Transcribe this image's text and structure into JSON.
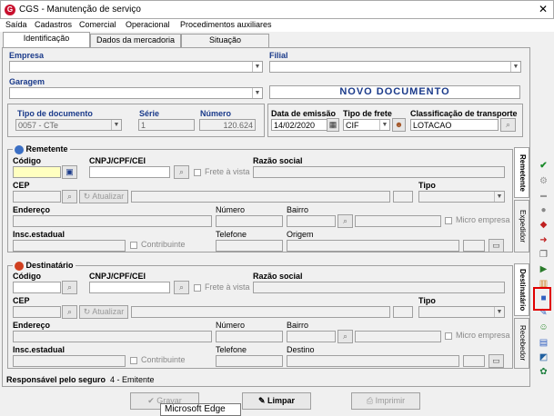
{
  "window": {
    "title": "CGS - Manutenção de serviço",
    "close": "✕"
  },
  "menu": [
    "Saída",
    "Cadastros",
    "Comercial",
    "Operacional",
    "Procedimentos auxiliares"
  ],
  "tabs": [
    "Identificação",
    "Dados da mercadoria",
    "Situação"
  ],
  "header": {
    "empresa_label": "Empresa",
    "filial_label": "Filial",
    "garagem_label": "Garagem",
    "status_banner": "NOVO DOCUMENTO",
    "tipo_doc_label": "Tipo de documento",
    "tipo_doc_value": "0057 - CTe",
    "serie_label": "Série",
    "serie_value": "1",
    "numero_label": "Número",
    "numero_value": "120.624",
    "data_emissao_label": "Data de emissão",
    "data_emissao_value": "14/02/2020",
    "tipo_frete_label": "Tipo de frete",
    "tipo_frete_value": "CIF",
    "classificacao_label": "Classificação de transporte",
    "classificacao_value": "LOTACAO"
  },
  "remetente": {
    "title": "Remetente",
    "codigo": "Código",
    "cnpj": "CNPJ/CPF/CEI",
    "frete_vista": "Frete à vista",
    "razao": "Razão social",
    "cep": "CEP",
    "atualizar": "Atualizar",
    "tipo": "Tipo",
    "endereco": "Endereço",
    "numero": "Número",
    "bairro": "Bairro",
    "micro": "Micro empresa",
    "insc": "Insc.estadual",
    "contribuinte": "Contribuinte",
    "telefone": "Telefone",
    "origem": "Origem"
  },
  "destinatario": {
    "title": "Destinatário",
    "codigo": "Código",
    "cnpj": "CNPJ/CPF/CEI",
    "frete_vista": "Frete à vista",
    "razao": "Razão social",
    "cep": "CEP",
    "atualizar": "Atualizar",
    "tipo": "Tipo",
    "endereco": "Endereço",
    "numero": "Número",
    "bairro": "Bairro",
    "micro": "Micro empresa",
    "insc": "Insc.estadual",
    "contribuinte": "Contribuinte",
    "telefone": "Telefone",
    "destino": "Destino"
  },
  "vtabs": {
    "remetente": "Remetente",
    "expedidor": "Expedidor",
    "destinatario": "Destinatário",
    "recebedor": "Recebedor"
  },
  "footer": {
    "responsavel_label": "Responsável pelo seguro",
    "responsavel_value": "4 - Emitente"
  },
  "buttons": {
    "gravar": "Gravar",
    "limpar": "Limpar",
    "imprimir": "Imprimir"
  },
  "tooltip": "Microsoft Edge",
  "sidebar_icons": [
    "check-icon",
    "gear-icon",
    "ruler-icon",
    "circle-icon",
    "book-icon",
    "arrow-icon",
    "copy-icon",
    "truck-icon",
    "chart-icon",
    "gift-icon",
    "edit-icon",
    "person-icon",
    "map-icon",
    "book2-icon",
    "globe-icon",
    "folder-icon"
  ],
  "colors": {
    "accent": "#1a3a8a",
    "highlight": "#ffffc0",
    "selection": "#e00000"
  }
}
